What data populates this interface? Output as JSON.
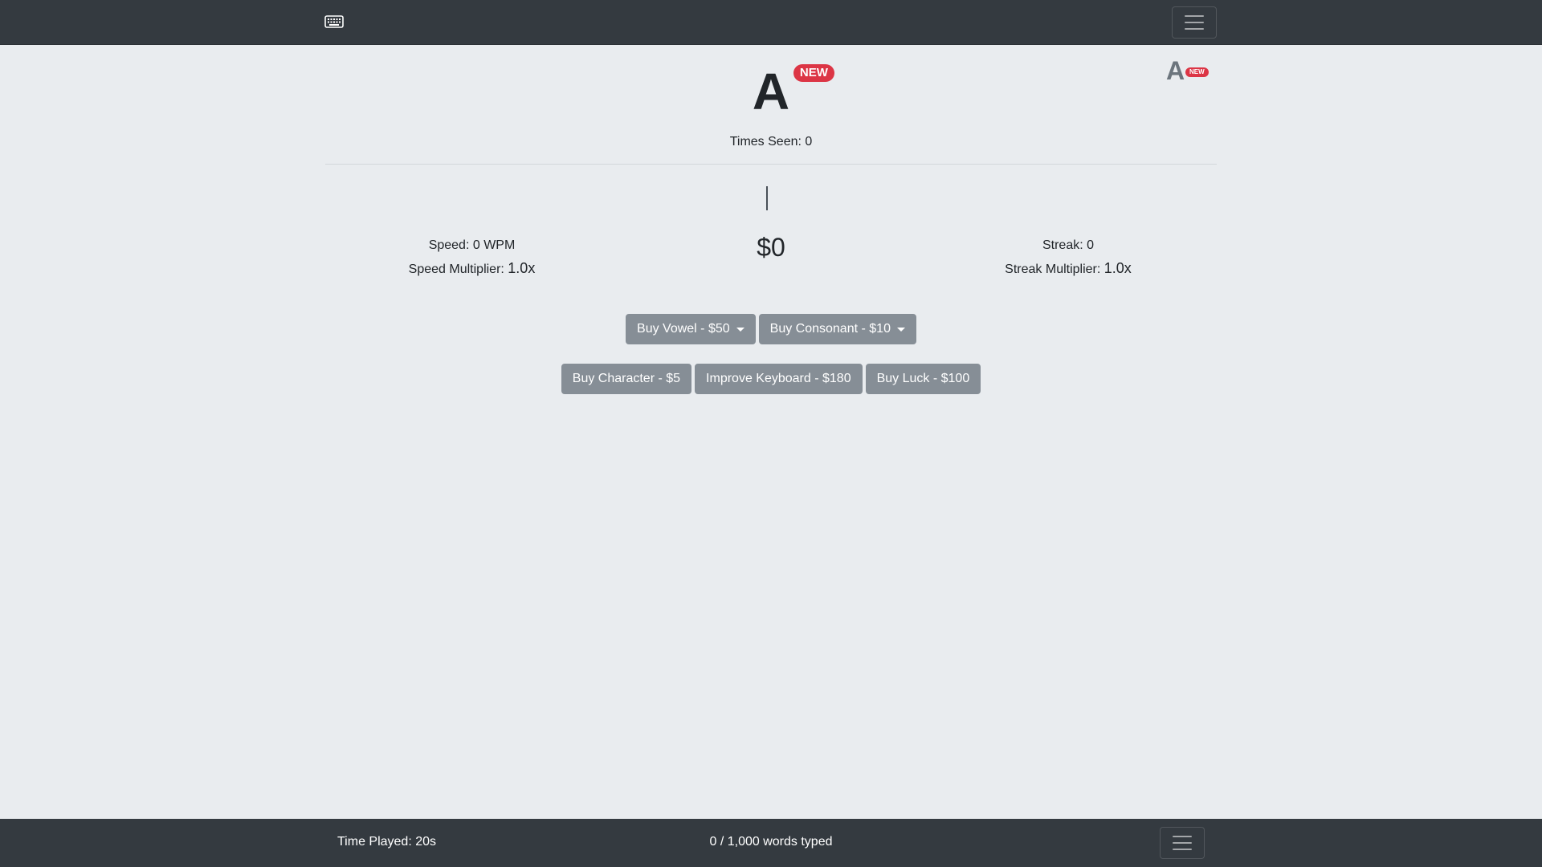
{
  "header": {
    "brand_icon": "keyboard-icon",
    "menu_icon": "hamburger-menu-icon"
  },
  "character": {
    "letter": "A",
    "badge": "NEW",
    "times_seen_label": "Times Seen: 0"
  },
  "corner_indicator": {
    "letter": "A",
    "badge": "NEW"
  },
  "stats": {
    "speed_label": "Speed: 0 WPM",
    "speed_multiplier_label": "Speed Multiplier:",
    "speed_multiplier_value": "1.0x",
    "money": "$0",
    "streak_label": "Streak: 0",
    "streak_multiplier_label": "Streak Multiplier:",
    "streak_multiplier_value": "1.0x"
  },
  "shop": {
    "buy_vowel": "Buy Vowel - $50",
    "buy_consonant": "Buy Consonant - $10",
    "buy_character": "Buy Character - $5",
    "improve_keyboard": "Improve Keyboard - $180",
    "buy_luck": "Buy Luck - $100"
  },
  "footer": {
    "time_played": "Time Played: 20s",
    "words_typed": "0 / 1,000 words typed",
    "menu_icon": "hamburger-menu-icon"
  },
  "colors": {
    "navbar_bg": "#343a40",
    "page_bg": "#e9ecef",
    "badge_red": "#dc3545",
    "button_gray": "#868e96"
  }
}
